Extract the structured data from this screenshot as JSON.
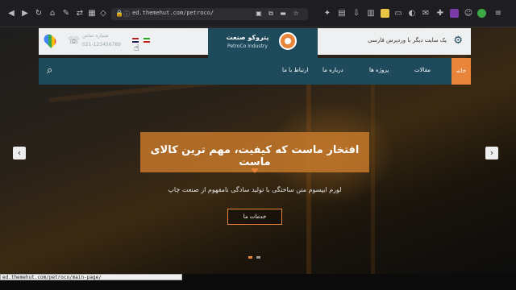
{
  "browser": {
    "url": "ed.themehut.com/petroco/",
    "status_url": "ed.themehut.com/petroco/main-page/"
  },
  "topbar": {
    "tagline": "یک سایت دیگر با وردپرس فارسی",
    "brand_name": "پتروکو صنعت",
    "brand_sub": "PetroCo Industry",
    "phone_title": "شماره تماس",
    "phone_sub": "021-123456789"
  },
  "nav": {
    "home": "خانه",
    "articles": "مقالات",
    "projects": "پروژه ها",
    "about": "درباره ما",
    "contact": "ارتباط با ما"
  },
  "hero": {
    "title": "افتخار ماست که کیفیت، مهم ترین کالای ماست",
    "subtitle": "لورم ایپسوم متن ساختگی با تولید سادگی نامفهوم از صنعت چاپ",
    "button": "خدمات ما"
  },
  "colors": {
    "accent": "#e9853a",
    "brand": "#1e4a5c"
  }
}
